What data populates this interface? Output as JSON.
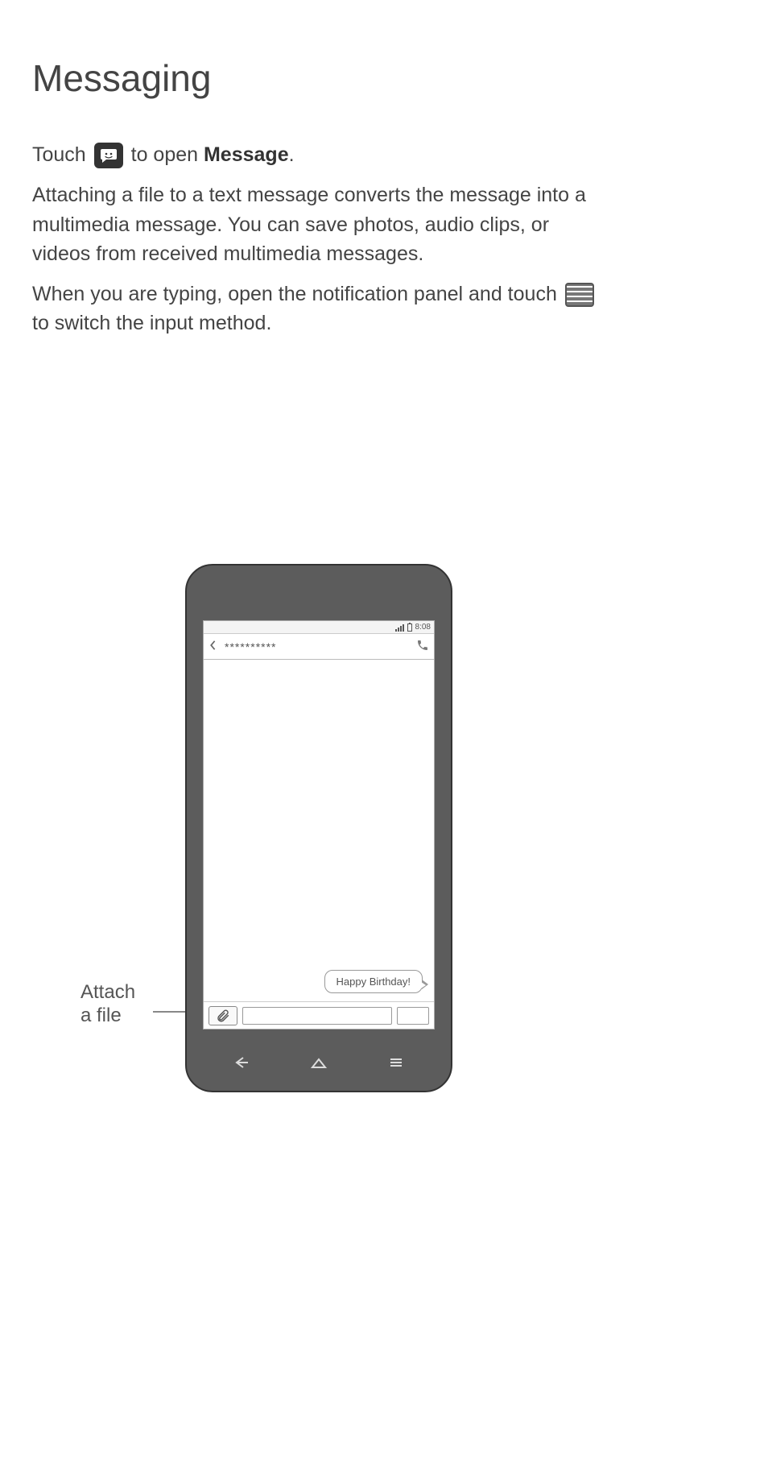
{
  "title": "Messaging",
  "para1": {
    "pre": "Touch ",
    "post": " to open ",
    "bold": "Message",
    "end": "."
  },
  "para2": "Attaching a file to a text message converts the message into a multimedia message. You can save photos, audio clips, or videos from received multimedia messages.",
  "para3": {
    "pre": "When you are typing, open the notification panel and touch ",
    "post": " to switch the input method."
  },
  "annotation": {
    "line1": "Attach",
    "line2": "a file"
  },
  "phone": {
    "status_time": "8:08",
    "contact_name": "**********",
    "bubble_text": "Happy Birthday!"
  }
}
